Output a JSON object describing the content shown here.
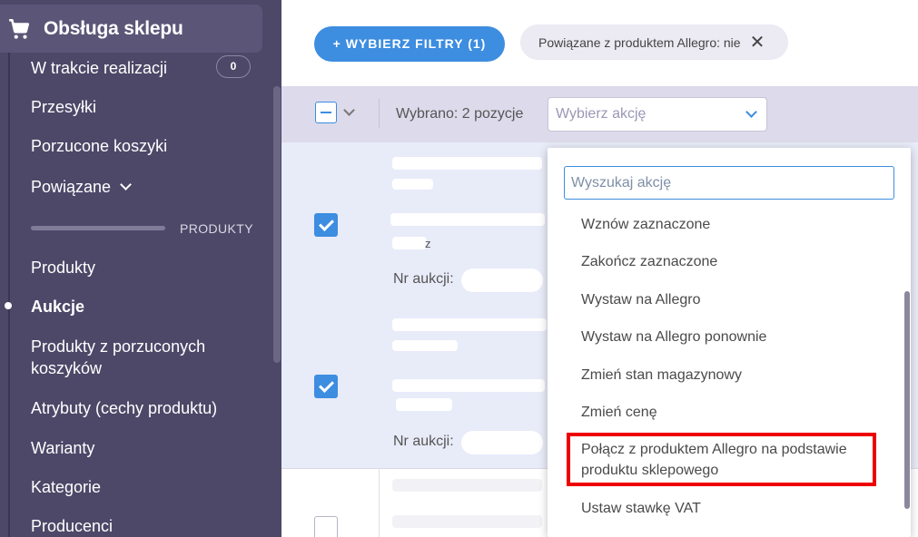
{
  "sidebar": {
    "title": "Obsługa sklepu",
    "items": [
      {
        "label": "W trakcie realizacji",
        "badge": "0"
      },
      {
        "label": "Przesyłki"
      },
      {
        "label": "Porzucone koszyki"
      },
      {
        "label": "Powiązane"
      }
    ],
    "section_label": "PRODUKTY",
    "products": [
      {
        "label": "Produkty"
      },
      {
        "label": "Aukcje",
        "active": true
      },
      {
        "label": "Produkty z porzuconych koszyków"
      },
      {
        "label": "Atrybuty (cechy produktu)"
      },
      {
        "label": "Warianty"
      },
      {
        "label": "Kategorie"
      },
      {
        "label": "Producenci"
      }
    ]
  },
  "toolbar": {
    "filters_button": "+ WYBIERZ FILTRY (1)",
    "chip_label": "Powiązane z produktem Allegro: nie"
  },
  "bulk": {
    "selected_text": "Wybrano: 2 pozycje",
    "action_placeholder": "Wybierz akcję"
  },
  "rows": {
    "auction_label": "Nr aukcji:",
    "frag_z": "z"
  },
  "dropdown": {
    "search_placeholder": "Wyszukaj akcję",
    "items": [
      "Wznów zaznaczone",
      "Zakończ zaznaczone",
      "Wystaw na Allegro",
      "Wystaw na Allegro ponownie",
      "Zmień stan magazynowy",
      "Zmień cenę",
      "Połącz z produktem Allegro na podstawie produktu sklepowego",
      "Ustaw stawkę VAT"
    ],
    "highlighted_index": 6
  },
  "colors": {
    "sidebar_bg": "#4d4868",
    "accent": "#3d8de0",
    "highlight_border": "#ee0000"
  }
}
